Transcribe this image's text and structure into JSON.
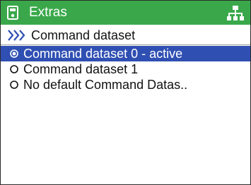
{
  "header": {
    "title": "Extras",
    "left_icon": "device-icon",
    "right_icon": "network-icon",
    "color": "#3aa84a"
  },
  "breadcrumb": {
    "label": "Command dataset",
    "icon": "triple-chevron-right-icon"
  },
  "list": {
    "selected_color": "#2f4fb3",
    "items": [
      {
        "label": "Command dataset 0 - active",
        "selected": true
      },
      {
        "label": "Command dataset 1",
        "selected": false
      },
      {
        "label": "No default Command Datas..",
        "selected": false
      }
    ]
  }
}
